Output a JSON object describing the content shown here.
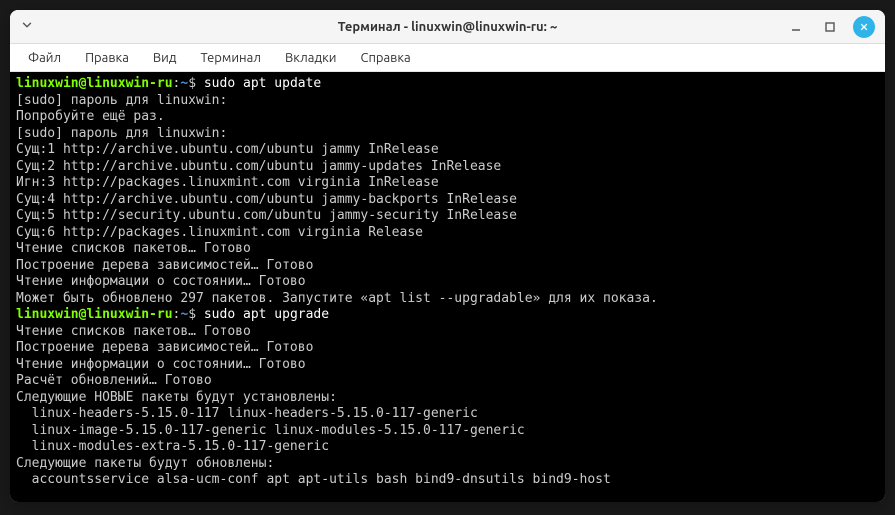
{
  "window": {
    "title": "Терминал - linuxwin@linuxwin-ru: ~"
  },
  "menu": {
    "file": "Файл",
    "edit": "Правка",
    "view": "Вид",
    "terminal": "Терминал",
    "tabs": "Вкладки",
    "help": "Справка"
  },
  "prompt": {
    "user_host": "linuxwin@linuxwin-ru",
    "colon": ":",
    "path": "~",
    "symbol": "$"
  },
  "commands": {
    "cmd1": "sudo apt update",
    "cmd2": "sudo apt upgrade"
  },
  "output": {
    "l1": "[sudo] пароль для linuxwin:",
    "l2": "Попробуйте ещё раз.",
    "l3": "[sudo] пароль для linuxwin:",
    "l4": "Сущ:1 http://archive.ubuntu.com/ubuntu jammy InRelease",
    "l5": "Сущ:2 http://archive.ubuntu.com/ubuntu jammy-updates InRelease",
    "l6": "Игн:3 http://packages.linuxmint.com virginia InRelease",
    "l7": "Сущ:4 http://archive.ubuntu.com/ubuntu jammy-backports InRelease",
    "l8": "Сущ:5 http://security.ubuntu.com/ubuntu jammy-security InRelease",
    "l9": "Сущ:6 http://packages.linuxmint.com virginia Release",
    "l10": "Чтение списков пакетов… Готово",
    "l11": "Построение дерева зависимостей… Готово",
    "l12": "Чтение информации о состоянии… Готово",
    "l13": "Может быть обновлено 297 пакетов. Запустите «apt list --upgradable» для их показа.",
    "l14": "Чтение списков пакетов… Готово",
    "l15": "Построение дерева зависимостей… Готово",
    "l16": "Чтение информации о состоянии… Готово",
    "l17": "Расчёт обновлений… Готово",
    "l18": "Следующие НОВЫЕ пакеты будут установлены:",
    "l19": "  linux-headers-5.15.0-117 linux-headers-5.15.0-117-generic",
    "l20": "  linux-image-5.15.0-117-generic linux-modules-5.15.0-117-generic",
    "l21": "  linux-modules-extra-5.15.0-117-generic",
    "l22": "Следующие пакеты будут обновлены:",
    "l23": "  accountsservice alsa-ucm-conf apt apt-utils bash bind9-dnsutils bind9-host"
  }
}
